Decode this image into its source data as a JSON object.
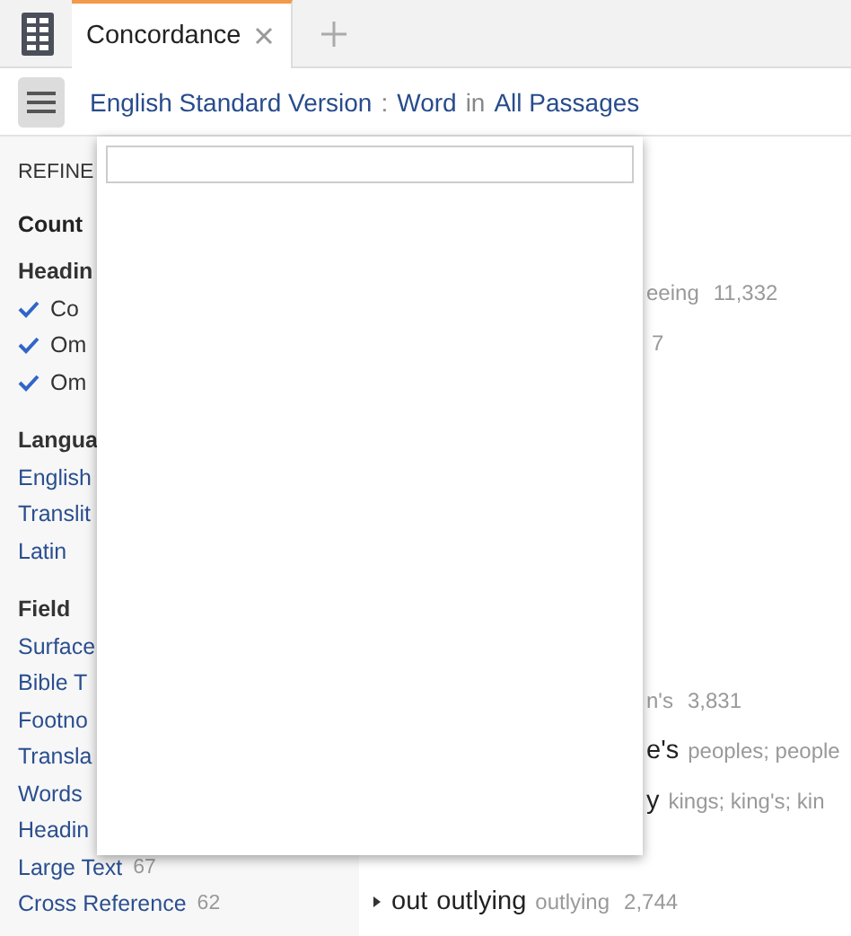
{
  "tab_bar": {
    "tabs": [
      {
        "label": "Concordance",
        "selected": true
      }
    ]
  },
  "toolbar": {
    "breadcrumb": [
      {
        "kind": "link",
        "text": "English Standard Version"
      },
      {
        "kind": "separator",
        "text": ":"
      },
      {
        "kind": "link",
        "text": "Word"
      },
      {
        "kind": "separator",
        "text": "in"
      },
      {
        "kind": "link",
        "text": "All Passages"
      }
    ]
  },
  "sidebar": {
    "items": [
      {
        "kind": "title",
        "text": "REFINE"
      },
      {
        "kind": "strong-heading",
        "text": "Count"
      },
      {
        "kind": "heading",
        "text": "Headin"
      },
      {
        "kind": "check",
        "text": "Co",
        "checked": true
      },
      {
        "kind": "check",
        "text": "Om",
        "checked": true
      },
      {
        "kind": "check",
        "text": "Om",
        "checked": true
      },
      {
        "kind": "heading",
        "text": "Langua"
      },
      {
        "kind": "link",
        "text": "English"
      },
      {
        "kind": "link",
        "text": "Translit"
      },
      {
        "kind": "link",
        "text": "Latin"
      },
      {
        "kind": "heading",
        "text": "Field"
      },
      {
        "kind": "link",
        "text": "Surface"
      },
      {
        "kind": "link",
        "text": "Bible T"
      },
      {
        "kind": "link",
        "text": "Footno"
      },
      {
        "kind": "link",
        "text": "Transla"
      },
      {
        "kind": "link",
        "text": "Words"
      },
      {
        "kind": "link",
        "text": "Headin"
      },
      {
        "kind": "link",
        "text": "Large Text",
        "count": "67"
      },
      {
        "kind": "link",
        "text": "Cross Reference",
        "count": "62"
      }
    ]
  },
  "dropdown": {
    "open": true
  },
  "results": [
    {
      "forms": "eeing",
      "count": "11,332"
    },
    {
      "count": "7"
    },
    {
      "forms": "n's",
      "count": "3,831"
    },
    {
      "word": "e's",
      "forms": "peoples; people"
    },
    {
      "word": "y",
      "forms": "kings; king's; kin"
    },
    {
      "expanded": false,
      "lemma": "out",
      "word": "outlying",
      "forms": "outlying",
      "count": "2,744"
    }
  ]
}
